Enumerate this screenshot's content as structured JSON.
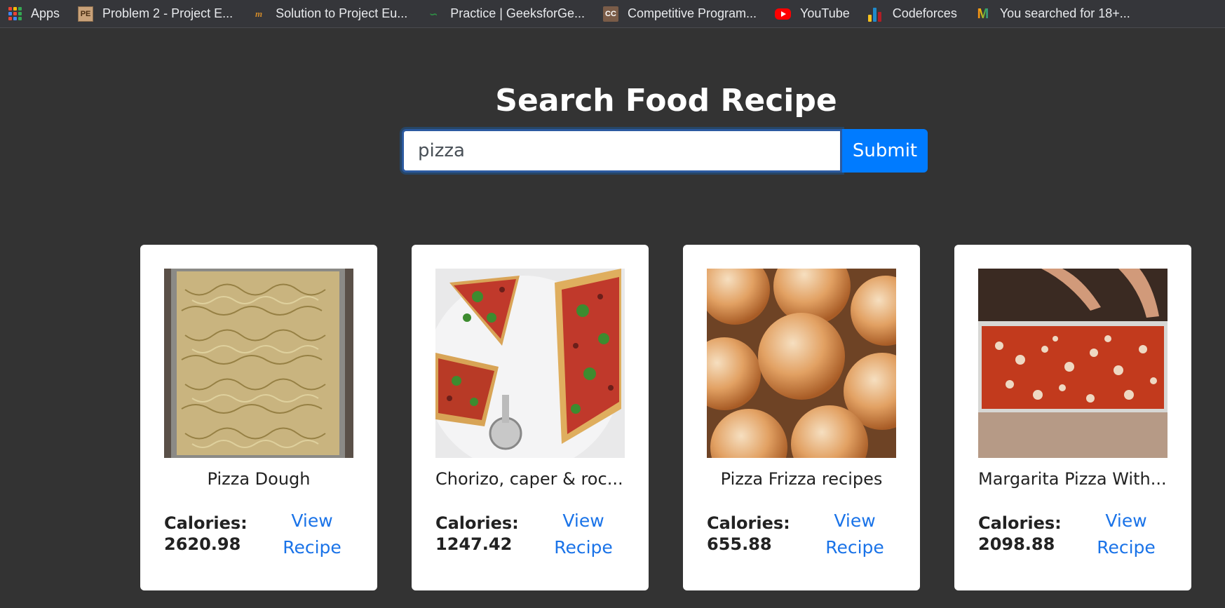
{
  "bookmarks": [
    {
      "label": "Apps",
      "icon": "apps-grid-icon"
    },
    {
      "label": "Problem 2 - Project E...",
      "icon": "project-euler-icon"
    },
    {
      "label": "Solution to Project Eu...",
      "icon": "mathblog-icon"
    },
    {
      "label": "Practice | GeeksforGe...",
      "icon": "geeksforgeeks-icon"
    },
    {
      "label": "Competitive Program...",
      "icon": "codechef-icon"
    },
    {
      "label": "YouTube",
      "icon": "youtube-icon"
    },
    {
      "label": "Codeforces",
      "icon": "codeforces-icon"
    },
    {
      "label": "You searched for 18+...",
      "icon": "m-logo-icon"
    }
  ],
  "page": {
    "title": "Search Food Recipe",
    "search_value": "pizza",
    "submit_label": "Submit"
  },
  "recipes": [
    {
      "name": "Pizza Dough",
      "calories_label": "Calories:",
      "calories": "2620.98",
      "link": "View Recipe",
      "image": "flatbread-with-onions"
    },
    {
      "name": "Chorizo, caper & roc...",
      "calories_label": "Calories:",
      "calories": "1247.42",
      "link": "View Recipe",
      "image": "pizza-slices-with-rocket"
    },
    {
      "name": "Pizza Frizza recipes",
      "calories_label": "Calories:",
      "calories": "655.88",
      "link": "View Recipe",
      "image": "sugared-dough-balls"
    },
    {
      "name": "Margarita Pizza With...",
      "calories_label": "Calories:",
      "calories": "2098.88",
      "link": "View Recipe",
      "image": "cheese-pizza-tray"
    }
  ],
  "colors": {
    "background": "#333333",
    "accent": "#007bff",
    "link": "#1a73e8",
    "card": "#ffffff"
  }
}
